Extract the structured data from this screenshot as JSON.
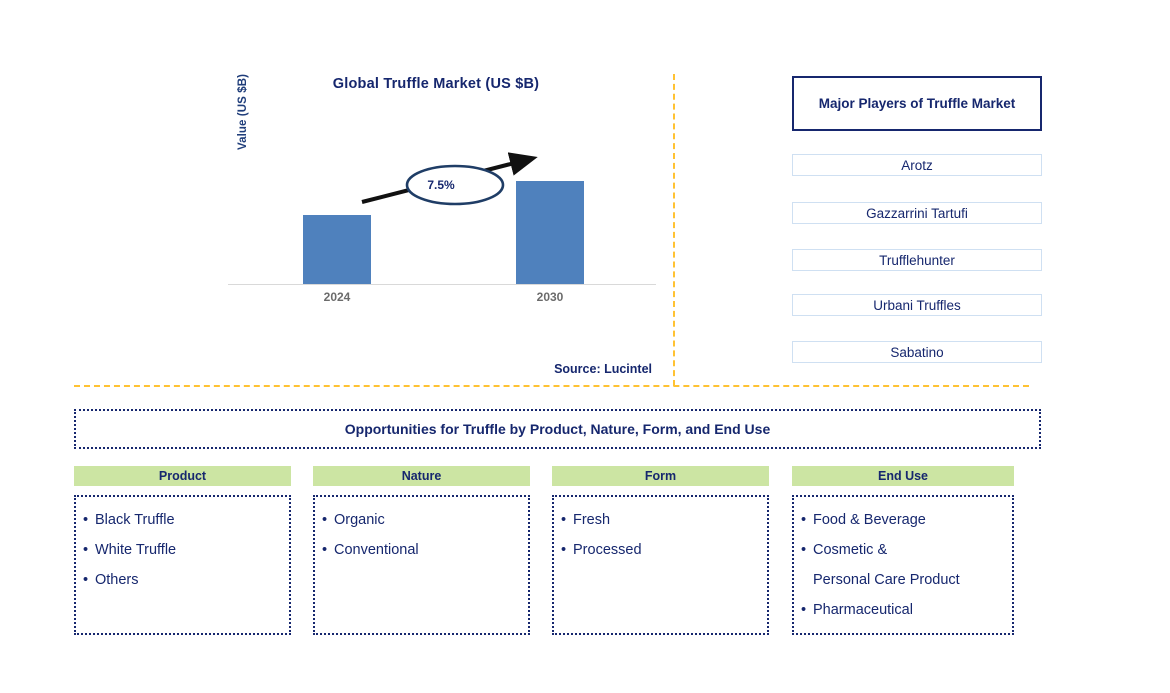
{
  "chart": {
    "title": "Global Truffle Market (US $B)",
    "ylabel": "Value (US $B)",
    "cagr_label": "7.5%",
    "source": "Source: Lucintel"
  },
  "chart_data": {
    "type": "bar",
    "title": "Global Truffle Market (US $B)",
    "categories": [
      "2024",
      "2030"
    ],
    "values": [
      1.0,
      1.54
    ],
    "value_labels": [
      "",
      ""
    ],
    "xlabel": "",
    "ylabel": "Value (US $B)",
    "ylim": [
      0,
      1.8
    ],
    "grid": false,
    "legend": false,
    "series_color": "#4f81bd",
    "annotations": [
      {
        "text": "7.5%",
        "type": "cagr-arrow",
        "from": "2024",
        "to": "2030"
      }
    ],
    "source": "Source: Lucintel"
  },
  "players": {
    "header": "Major Players of Truffle Market",
    "items": [
      "Arotz",
      "Gazzarrini Tartufi",
      "Trufflehunter",
      "Urbani Truffles",
      "Sabatino"
    ]
  },
  "opportunities": {
    "banner": "Opportunities for Truffle by Product, Nature, Form, and End Use",
    "columns": [
      {
        "header": "Product",
        "items": [
          "Black Truffle",
          "White Truffle",
          "Others"
        ]
      },
      {
        "header": "Nature",
        "items": [
          "Organic",
          "Conventional"
        ]
      },
      {
        "header": "Form",
        "items": [
          "Fresh",
          "Processed"
        ]
      },
      {
        "header": "End Use",
        "items": [
          "Food & Beverage",
          "Cosmetic &\nPersonal Care Product",
          "Pharmaceutical"
        ]
      }
    ]
  },
  "colors": {
    "bar": "#4f81bd",
    "navy": "#16276e",
    "green_header": "#cce5a3",
    "divider_gold": "#ffc233"
  },
  "bullet": "•"
}
